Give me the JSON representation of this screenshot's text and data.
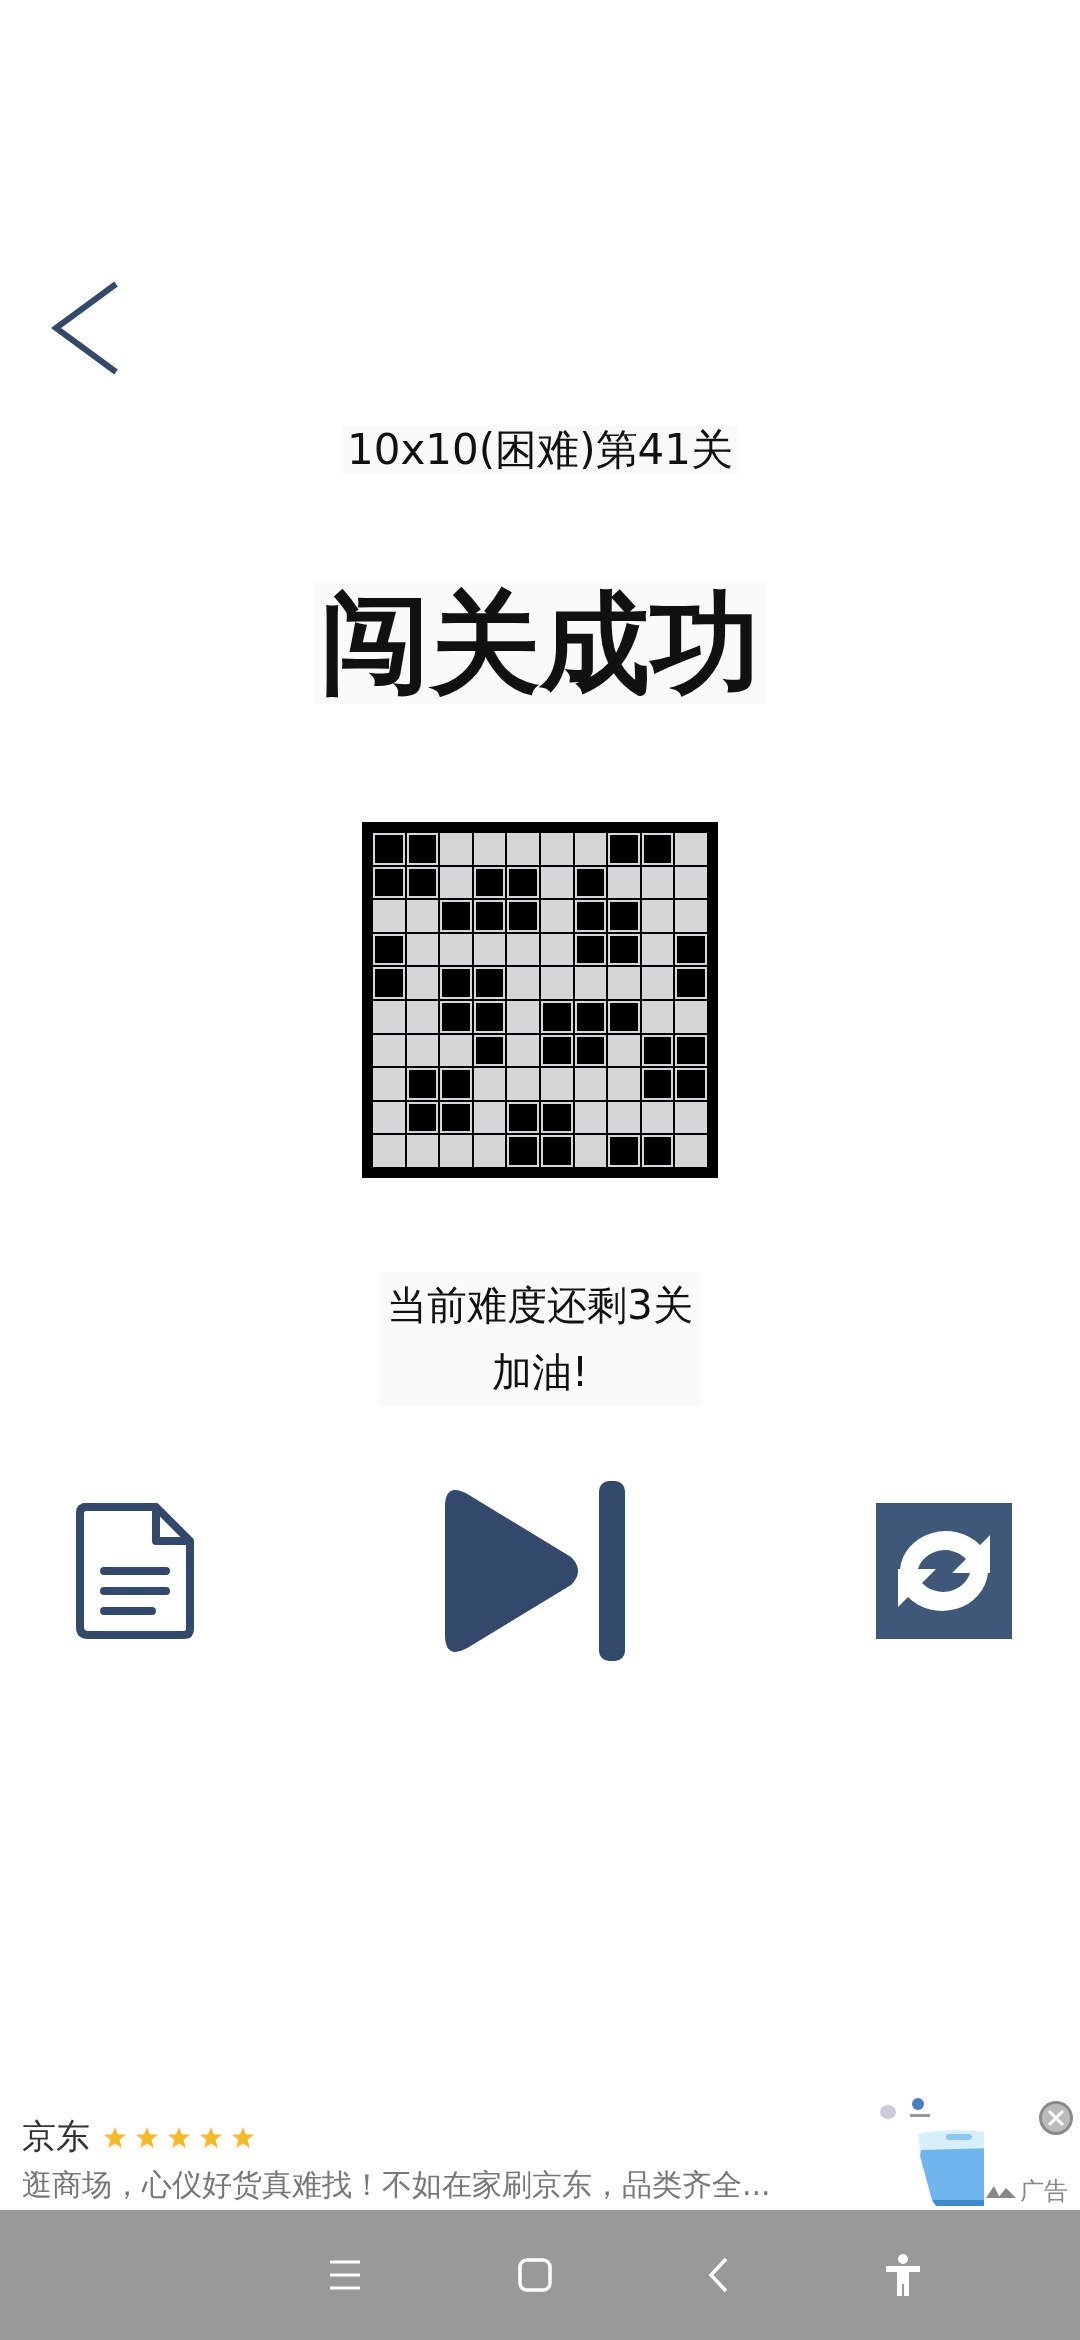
{
  "level_title": "10x10(困难)第41关",
  "result": "闯关成功",
  "grid": [
    [
      true,
      true,
      false,
      false,
      false,
      false,
      false,
      true,
      true,
      false
    ],
    [
      true,
      true,
      false,
      true,
      true,
      false,
      true,
      false,
      false,
      false
    ],
    [
      false,
      false,
      true,
      true,
      true,
      false,
      true,
      true,
      false,
      false
    ],
    [
      true,
      false,
      false,
      false,
      false,
      false,
      true,
      true,
      false,
      true
    ],
    [
      true,
      false,
      true,
      true,
      false,
      false,
      false,
      false,
      false,
      true
    ],
    [
      false,
      false,
      true,
      true,
      false,
      true,
      true,
      true,
      false,
      false
    ],
    [
      false,
      false,
      false,
      true,
      false,
      true,
      true,
      false,
      true,
      true
    ],
    [
      false,
      true,
      true,
      false,
      false,
      false,
      false,
      false,
      true,
      true
    ],
    [
      false,
      true,
      true,
      false,
      true,
      true,
      false,
      false,
      false,
      false
    ],
    [
      false,
      false,
      false,
      false,
      true,
      true,
      false,
      true,
      true,
      false
    ]
  ],
  "message": [
    "当前难度还剩3关",
    "加油!"
  ],
  "ad": {
    "brand": "京东",
    "stars": 5,
    "text": "逛商场，心仪好货真难找！不如在家刷京东，品类齐全...",
    "label": "广告"
  }
}
